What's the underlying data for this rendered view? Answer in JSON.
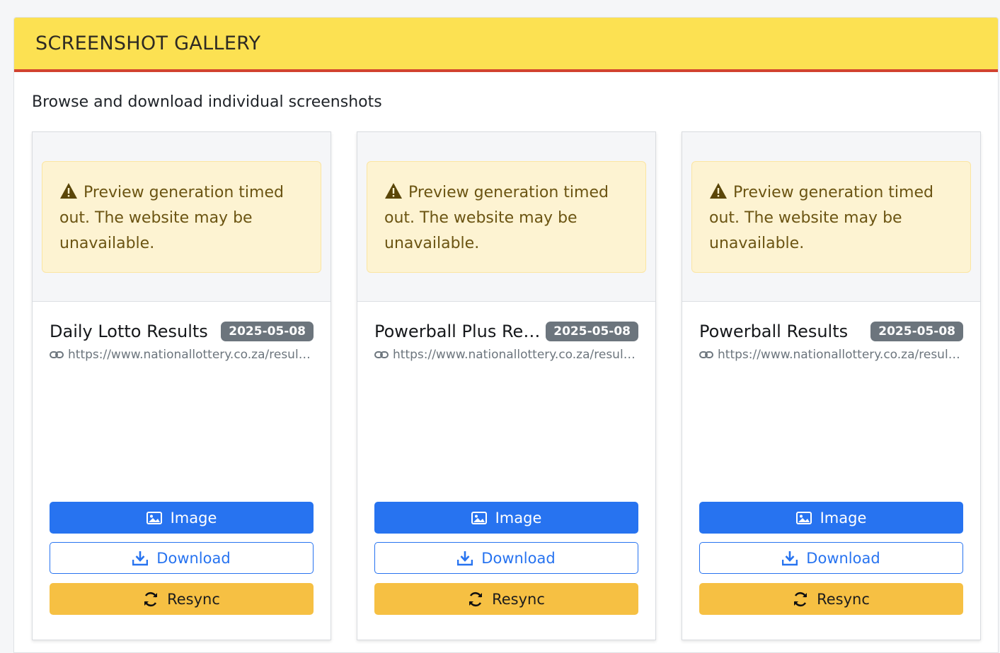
{
  "header": {
    "title": "SCREENSHOT GALLERY"
  },
  "subtitle": "Browse and download individual screenshots",
  "colors": {
    "header_bg": "#fce152",
    "header_border": "#d2432f",
    "primary": "#2773f0",
    "warning": "#f6c043",
    "badge": "#6c757d",
    "alert_bg": "#fdf3d2"
  },
  "cards": [
    {
      "alert_icon": "warning-triangle-icon",
      "alert_text": "Preview generation timed out. The website may be unavailable.",
      "title": "Daily Lotto Results",
      "date": "2025-05-08",
      "url": "https://www.nationallottery.co.za/results/...",
      "buttons": {
        "image": "Image",
        "download": "Download",
        "resync": "Resync"
      }
    },
    {
      "alert_icon": "warning-triangle-icon",
      "alert_text": "Preview generation timed out. The website may be unavailable.",
      "title": "Powerball Plus Res...",
      "date": "2025-05-08",
      "url": "https://www.nationallottery.co.za/results/...",
      "buttons": {
        "image": "Image",
        "download": "Download",
        "resync": "Resync"
      }
    },
    {
      "alert_icon": "warning-triangle-icon",
      "alert_text": "Preview generation timed out. The website may be unavailable.",
      "title": "Powerball Results",
      "date": "2025-05-08",
      "url": "https://www.nationallottery.co.za/results/...",
      "buttons": {
        "image": "Image",
        "download": "Download",
        "resync": "Resync"
      }
    }
  ]
}
